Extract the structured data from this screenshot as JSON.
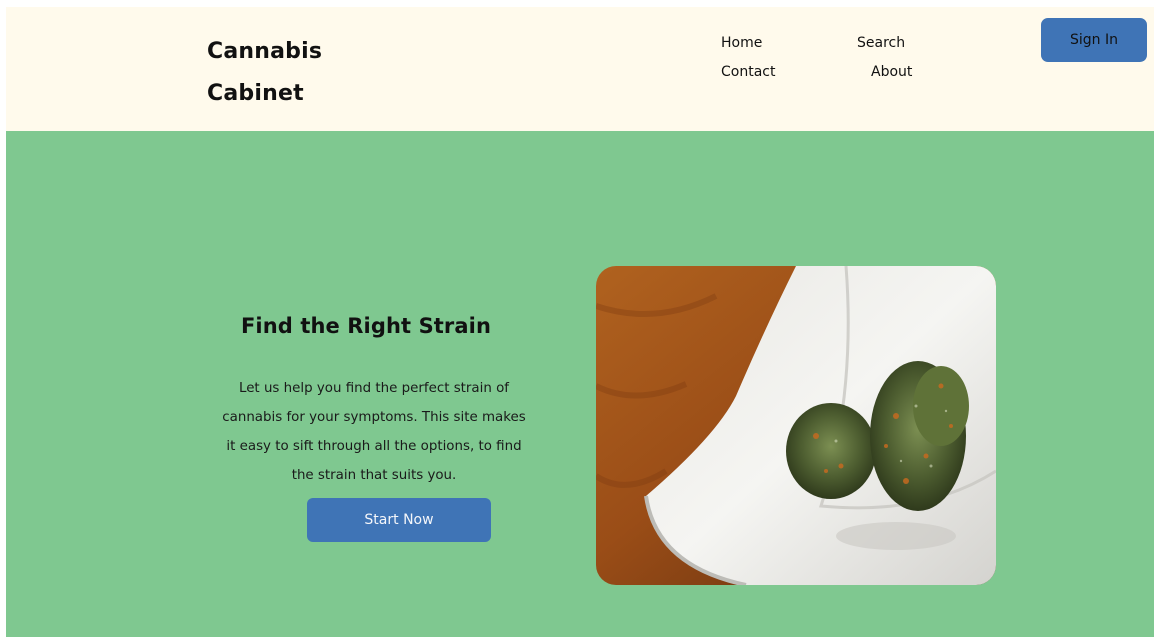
{
  "header": {
    "logo_line1": "Cannabis",
    "logo_line2": "Cabinet",
    "nav": {
      "home": "Home",
      "search": "Search",
      "contact": "Contact",
      "about": "About"
    },
    "sign_in": "Sign In"
  },
  "hero": {
    "title": "Find the Right Strain",
    "body": "Let us help you find the perfect strain of cannabis for your symptoms. This site makes it easy to sift through all the options, to find the strain that suits you.",
    "cta": "Start Now"
  },
  "colors": {
    "header_bg": "#fffaec",
    "hero_bg": "#7fc890",
    "button": "#3f74b6"
  },
  "icons": {
    "hero_image": "cannabis-buds-on-white-dish"
  }
}
